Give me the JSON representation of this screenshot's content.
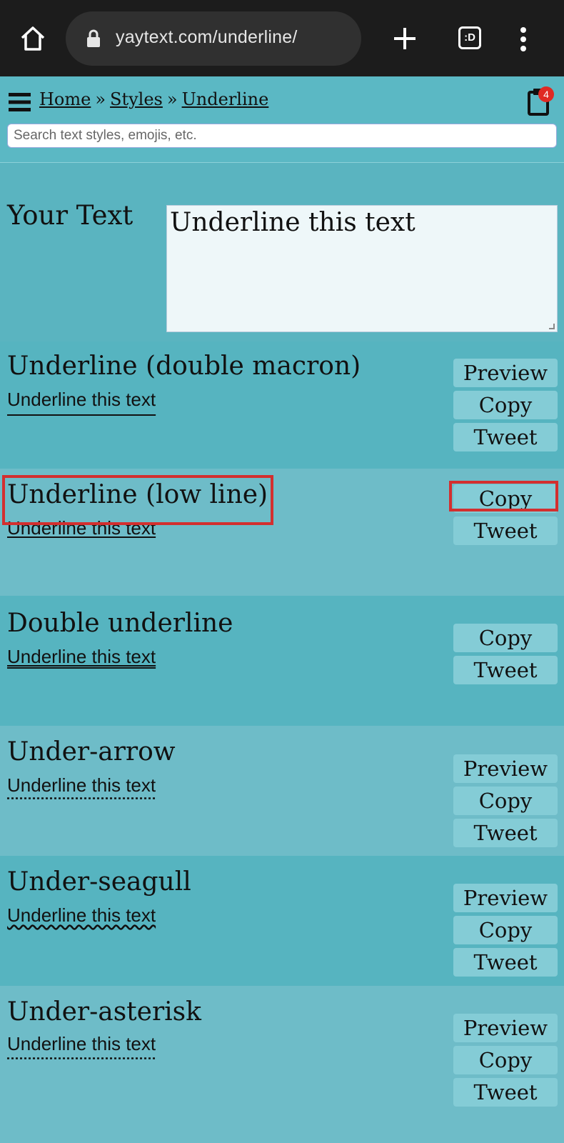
{
  "browser": {
    "url": "yaytext.com/underline/",
    "tabs_label": ":D"
  },
  "header": {
    "breadcrumbs": [
      "Home",
      "Styles",
      "Underline"
    ],
    "separator": "»",
    "clipboard_count": "4",
    "search_placeholder": "Search text styles, emojis, etc."
  },
  "input": {
    "label": "Your Text",
    "value": "Underline this text"
  },
  "styles": [
    {
      "title": "Underline (double macron)",
      "sample": "Underline this text",
      "buttons": [
        "Preview",
        "Copy",
        "Tweet"
      ]
    },
    {
      "title": "Underline (low line)",
      "sample": "Underline this text",
      "buttons": [
        "Copy",
        "Tweet"
      ]
    },
    {
      "title": "Double underline",
      "sample": "Underline this text",
      "buttons": [
        "Copy",
        "Tweet"
      ]
    },
    {
      "title": "Under-arrow",
      "sample": "Underline this text",
      "buttons": [
        "Preview",
        "Copy",
        "Tweet"
      ]
    },
    {
      "title": "Under-seagull",
      "sample": "Underline this text",
      "buttons": [
        "Preview",
        "Copy",
        "Tweet"
      ]
    },
    {
      "title": "Under-asterisk",
      "sample": "Underline this text",
      "buttons": [
        "Preview",
        "Copy",
        "Tweet"
      ]
    }
  ],
  "colors": {
    "background": "#5ab4c0",
    "button": "#84ccd6",
    "highlight": "#d32f2f",
    "badge": "#e02a24"
  }
}
